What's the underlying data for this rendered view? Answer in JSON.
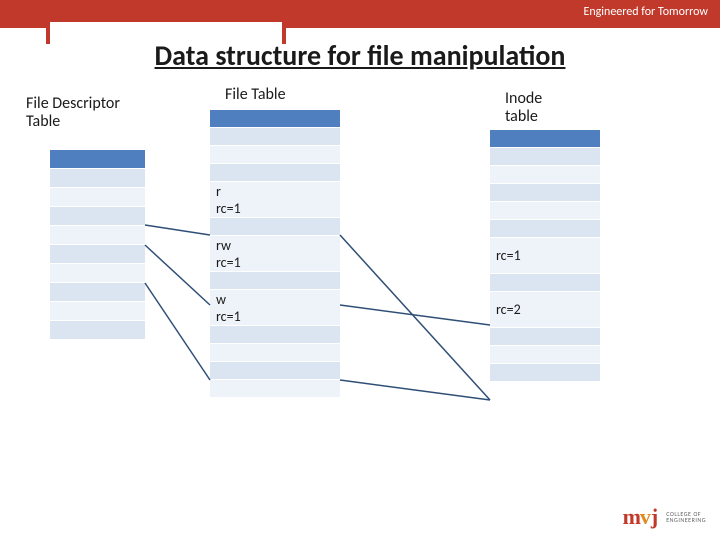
{
  "tagline": "Engineered for Tomorrow",
  "title": "Data structure for file manipulation",
  "labels": {
    "fdt": "File Descriptor\nTable",
    "file_table": "File Table",
    "inode_table": "Inode\ntable"
  },
  "fdt_rows": [
    "",
    "",
    "",
    "",
    "",
    "",
    "",
    "",
    ""
  ],
  "file_table_rows": [
    "",
    "",
    "",
    "r\nrc=1",
    "",
    "rw\nrc=1",
    "",
    "w\nrc=1",
    "",
    "",
    "",
    ""
  ],
  "inode_rows": [
    "",
    "",
    "",
    "",
    "",
    "rc=1",
    "",
    "rc=2",
    "",
    "",
    ""
  ],
  "logo": {
    "m": "m",
    "v": "v",
    "j": "j",
    "sub1": "COLLEGE OF",
    "sub2": "ENGINEERING"
  }
}
